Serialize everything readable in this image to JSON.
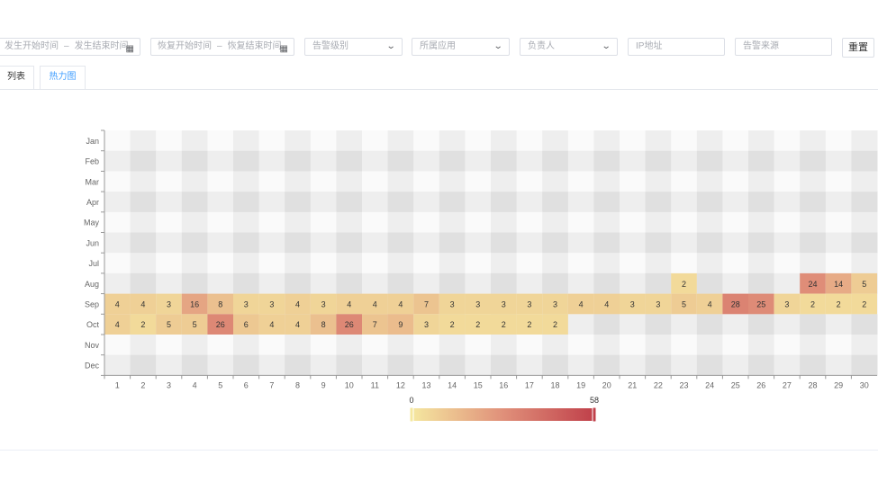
{
  "filters": {
    "occur_start": "发生开始时间",
    "occur_end": "发生结束时间",
    "recover_start": "恢复开始时间",
    "recover_end": "恢复结束时间",
    "range_sep": "–",
    "level": "告警级别",
    "app": "所属应用",
    "owner": "负责人",
    "ip": "IP地址",
    "source": "告警来源",
    "reset": "重置"
  },
  "tabs": [
    {
      "label": "列表",
      "active": false
    },
    {
      "label": "热力图",
      "active": true
    }
  ],
  "chart_data": {
    "type": "heatmap",
    "x": [
      "1",
      "2",
      "3",
      "4",
      "5",
      "6",
      "7",
      "8",
      "9",
      "10",
      "11",
      "12",
      "13",
      "14",
      "15",
      "16",
      "17",
      "18",
      "19",
      "20",
      "21",
      "22",
      "23",
      "24",
      "25",
      "26",
      "27",
      "28",
      "29",
      "30"
    ],
    "y": [
      "Jan",
      "Feb",
      "Mar",
      "Apr",
      "May",
      "Jun",
      "Jul",
      "Aug",
      "Sep",
      "Oct",
      "Nov",
      "Dec"
    ],
    "cells": [
      [
        "Aug",
        "23",
        2
      ],
      [
        "Aug",
        "28",
        24
      ],
      [
        "Aug",
        "29",
        14
      ],
      [
        "Aug",
        "30",
        5
      ],
      [
        "Sep",
        "1",
        4
      ],
      [
        "Sep",
        "2",
        4
      ],
      [
        "Sep",
        "3",
        3
      ],
      [
        "Sep",
        "4",
        16
      ],
      [
        "Sep",
        "5",
        8
      ],
      [
        "Sep",
        "6",
        3
      ],
      [
        "Sep",
        "7",
        3
      ],
      [
        "Sep",
        "8",
        4
      ],
      [
        "Sep",
        "9",
        3
      ],
      [
        "Sep",
        "10",
        4
      ],
      [
        "Sep",
        "11",
        4
      ],
      [
        "Sep",
        "12",
        4
      ],
      [
        "Sep",
        "13",
        7
      ],
      [
        "Sep",
        "14",
        3
      ],
      [
        "Sep",
        "15",
        3
      ],
      [
        "Sep",
        "16",
        3
      ],
      [
        "Sep",
        "17",
        3
      ],
      [
        "Sep",
        "18",
        3
      ],
      [
        "Sep",
        "19",
        4
      ],
      [
        "Sep",
        "20",
        4
      ],
      [
        "Sep",
        "21",
        3
      ],
      [
        "Sep",
        "22",
        3
      ],
      [
        "Sep",
        "23",
        5
      ],
      [
        "Sep",
        "24",
        4
      ],
      [
        "Sep",
        "25",
        28
      ],
      [
        "Sep",
        "26",
        25
      ],
      [
        "Sep",
        "27",
        3
      ],
      [
        "Sep",
        "28",
        2
      ],
      [
        "Sep",
        "29",
        2
      ],
      [
        "Sep",
        "30",
        2
      ],
      [
        "Oct",
        "1",
        4
      ],
      [
        "Oct",
        "2",
        2
      ],
      [
        "Oct",
        "3",
        5
      ],
      [
        "Oct",
        "4",
        5
      ],
      [
        "Oct",
        "5",
        26
      ],
      [
        "Oct",
        "6",
        6
      ],
      [
        "Oct",
        "7",
        4
      ],
      [
        "Oct",
        "8",
        4
      ],
      [
        "Oct",
        "9",
        8
      ],
      [
        "Oct",
        "10",
        26
      ],
      [
        "Oct",
        "11",
        7
      ],
      [
        "Oct",
        "12",
        9
      ],
      [
        "Oct",
        "13",
        3
      ],
      [
        "Oct",
        "14",
        2
      ],
      [
        "Oct",
        "15",
        2
      ],
      [
        "Oct",
        "16",
        2
      ],
      [
        "Oct",
        "17",
        2
      ],
      [
        "Oct",
        "18",
        2
      ]
    ],
    "visual_map": {
      "min": 0,
      "max": 58,
      "min_label": "0",
      "max_label": "58",
      "colors": [
        "#f5e8a0",
        "#c0404a"
      ]
    },
    "stripe_colors": [
      "#fafafa",
      "#eeeeee",
      "#e0e0e0"
    ]
  }
}
